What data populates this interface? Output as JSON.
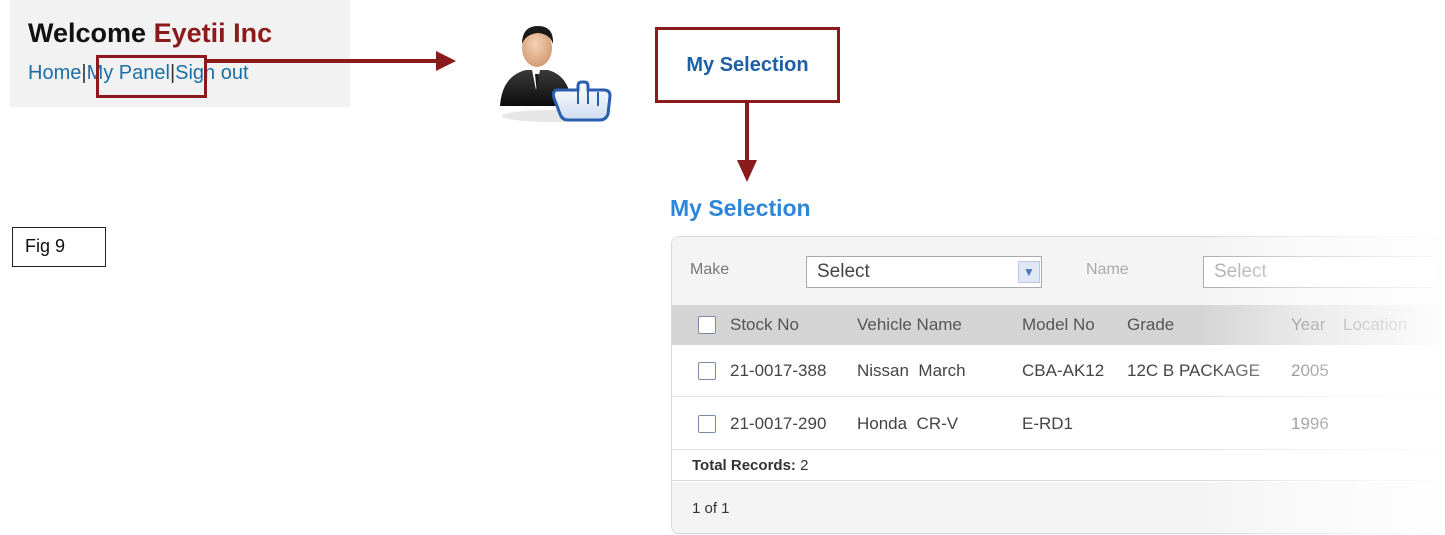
{
  "header": {
    "welcome_text": "Welcome",
    "company_name": "Eyetii Inc",
    "nav": {
      "home": "Home",
      "my_panel": "My Panel",
      "sign_out": "Sign out",
      "separator": "|"
    }
  },
  "callout": {
    "label": "My Selection"
  },
  "figure": {
    "label": "Fig 9"
  },
  "section": {
    "heading": "My Selection"
  },
  "filters": {
    "make_label": "Make",
    "make_value": "Select",
    "name_label": "Name",
    "name_value": "Select"
  },
  "grid": {
    "columns": [
      "Stock No",
      "Vehicle Name",
      "Model No",
      "Grade",
      "Year",
      "Location"
    ],
    "rows": [
      {
        "stock_no": "21-0017-388",
        "vehicle_name": "Nissan  March",
        "model_no": "CBA-AK12",
        "grade": "12C B PACKAGE",
        "year": "2005"
      },
      {
        "stock_no": "21-0017-290",
        "vehicle_name": "Honda  CR-V",
        "model_no": "E-RD1",
        "grade": "",
        "year": "1996"
      }
    ],
    "total_label": "Total Records:",
    "total_value": "2",
    "pager": "1 of 1"
  },
  "colors": {
    "accent_dark_red": "#8b1a1a",
    "link_blue": "#1a6fa8",
    "heading_blue": "#2e86d6"
  }
}
